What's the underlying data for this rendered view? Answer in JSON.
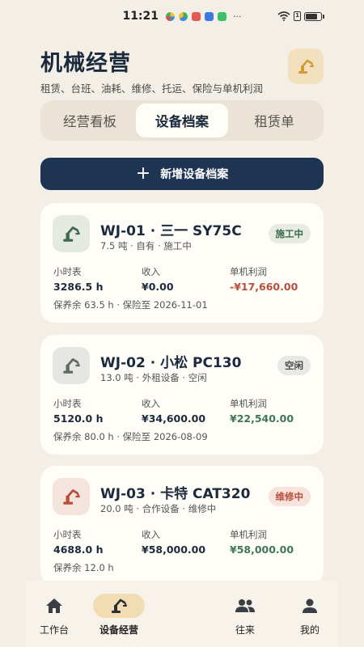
{
  "status_bar": {
    "time": "11:21",
    "dots": "···",
    "sim_label": "1"
  },
  "header": {
    "title": "机械经营",
    "subtitle": "租赁、台班、油耗、维修、托运、保险与单机利润",
    "badge_icon": "excavator-icon"
  },
  "tabs": [
    {
      "label": "经营看板",
      "active": false
    },
    {
      "label": "设备档案",
      "active": true
    },
    {
      "label": "租赁单",
      "active": false
    }
  ],
  "add_button": {
    "label": "新增设备档案",
    "icon": "plus-icon"
  },
  "metric_labels": {
    "hours": "小时表",
    "income": "收入",
    "profit": "单机利润"
  },
  "equipment": [
    {
      "title": "WJ-01 · 三一 SY75C",
      "meta": "7.5 吨 · 自有 · 施工中",
      "status": "施工中",
      "hours": "3286.5 h",
      "income": "¥0.00",
      "profit": "-¥17,660.00",
      "foot": "保养余 63.5 h · 保险至 2026-11-01"
    },
    {
      "title": "WJ-02 · 小松 PC130",
      "meta": "13.0 吨 · 外租设备 · 空闲",
      "status": "空闲",
      "hours": "5120.0 h",
      "income": "¥34,600.00",
      "profit": "¥22,540.00",
      "foot": "保养余 80.0 h · 保险至 2026-08-09"
    },
    {
      "title": "WJ-03 · 卡特 CAT320",
      "meta": "20.0 吨 · 合作设备 · 维修中",
      "status": "维修中",
      "hours": "4688.0 h",
      "income": "¥58,000.00",
      "profit": "¥58,000.00",
      "foot": "保养余 12.0 h"
    }
  ],
  "colors": {
    "background": "#f4efe6",
    "primary": "#1d3552",
    "accent": "#d39a3a",
    "status_working_bg": "#e7ebe2",
    "status_working_fg": "#3c6a4c",
    "status_idle_bg": "#e8e8e4",
    "status_idle_fg": "#4a4a4a",
    "status_repair_bg": "#f7e2dc",
    "status_repair_fg": "#b5503c",
    "profit_negative": "#b5503c",
    "profit_positive": "#3f7654"
  },
  "bottom_nav": [
    {
      "label": "工作台",
      "icon": "home-icon",
      "active": false
    },
    {
      "label": "设备经营",
      "icon": "excavator-icon",
      "active": true
    },
    {
      "label": "往来",
      "icon": "people-icon",
      "active": false
    },
    {
      "label": "我的",
      "icon": "person-icon",
      "active": false
    }
  ]
}
